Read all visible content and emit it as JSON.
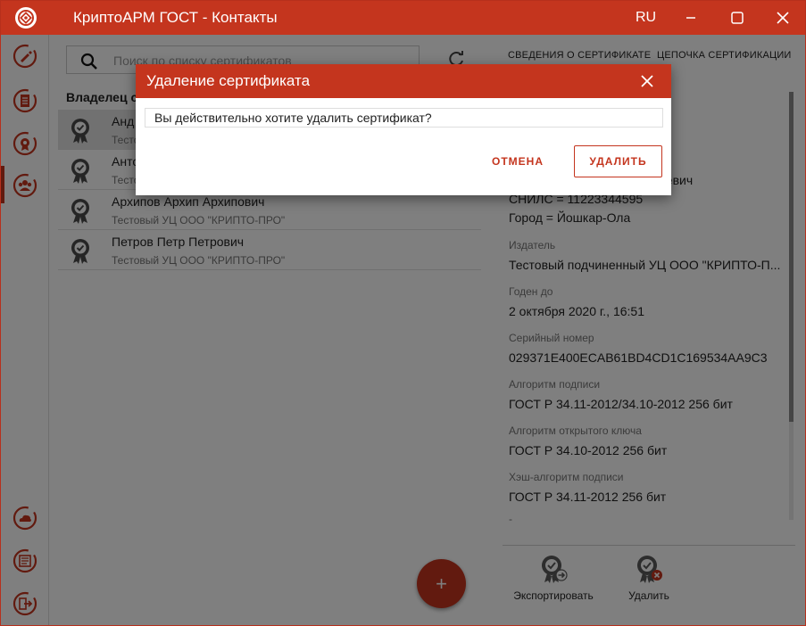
{
  "window": {
    "title": "КриптоАРМ ГОСТ - Контакты",
    "lang": "RU",
    "colors": {
      "brand": "#c4351e",
      "selected_row": "#e3e3e3"
    }
  },
  "rail": {
    "items": [
      {
        "icon": "sign-pen-icon"
      },
      {
        "icon": "document-list-icon"
      },
      {
        "icon": "certificate-gear-icon"
      },
      {
        "icon": "contacts-people-icon"
      },
      {
        "icon": "cloud-icon"
      },
      {
        "icon": "journal-list-icon"
      },
      {
        "icon": "logout-icon"
      }
    ]
  },
  "search": {
    "placeholder": "Поиск по списку сертификатов"
  },
  "list": {
    "header": "Владелец се",
    "items": [
      {
        "name": "Анд",
        "issuer": "Тесто"
      },
      {
        "name": "Анто",
        "issuer": "Тесто"
      },
      {
        "name": "Архипов Архип Архипович",
        "issuer": "Тестовый УЦ ООО \"КРИПТО-ПРО\""
      },
      {
        "name": "Петров Петр Петрович",
        "issuer": "Тестовый УЦ ООО \"КРИПТО-ПРО\""
      }
    ]
  },
  "fab": {
    "label": "+"
  },
  "details": {
    "tabs": [
      "СВЕДЕНИЯ О СЕРТИФИКАТЕ",
      "ЦЕПОЧКА СЕРТИФИКАЦИИ"
    ],
    "subject_tail": "еевич",
    "subject_lines": [
      "СНИЛС = 11223344595",
      "Город = Йошкар-Ола"
    ],
    "fields": [
      {
        "label": "Издатель",
        "value": "Тестовый подчиненный УЦ ООО \"КРИПТО-П..."
      },
      {
        "label": "Годен до",
        "value": "2 октября 2020 г., 16:51"
      },
      {
        "label": "Серийный номер",
        "value": "029371E400ECAB61BD4CD1C169534AA9C3"
      },
      {
        "label": "Алгоритм подписи",
        "value": "ГОСТ Р 34.11-2012/34.10-2012 256 бит"
      },
      {
        "label": "Алгоритм открытого ключа",
        "value": "ГОСТ Р 34.10-2012 256 бит"
      },
      {
        "label": "Хэш-алгоритм подписи",
        "value": "ГОСТ Р 34.11-2012 256 бит"
      }
    ],
    "trailing": "-",
    "actions": [
      {
        "label": "Экспортировать",
        "icon": "export-certificate-icon"
      },
      {
        "label": "Удалить",
        "icon": "delete-certificate-icon"
      }
    ]
  },
  "dialog": {
    "title": "Удаление сертификата",
    "message": "Вы действительно хотите удалить сертификат?",
    "cancel_label": "ОТМЕНА",
    "delete_label": "УДАЛИТЬ"
  }
}
